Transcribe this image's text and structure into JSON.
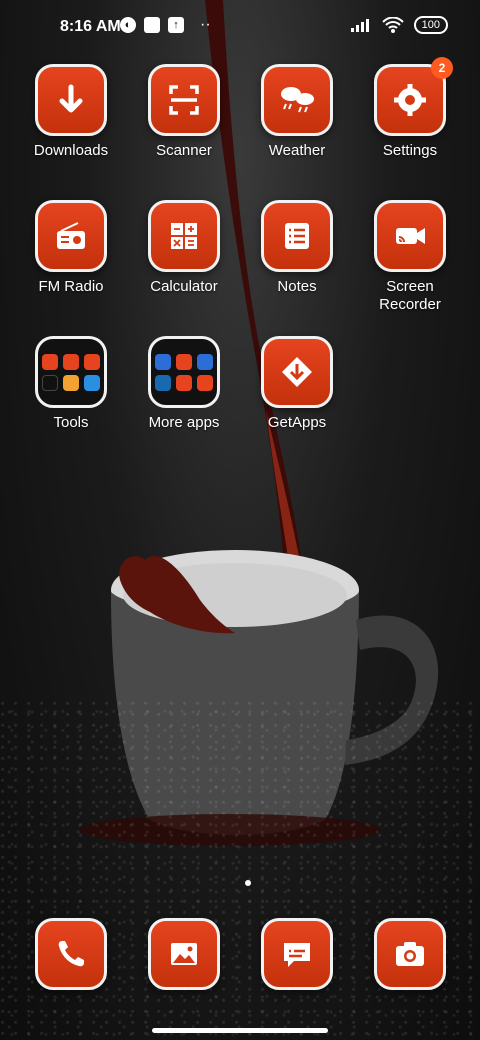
{
  "status_bar": {
    "time": "8:16 AM",
    "battery": "100",
    "left_icons": [
      "notification-icon",
      "square-icon",
      "upload-icon"
    ],
    "right_icons": [
      "signal-icon",
      "wifi-icon",
      "battery-icon"
    ]
  },
  "apps": [
    {
      "label": "Downloads",
      "icon": "download-icon"
    },
    {
      "label": "Scanner",
      "icon": "scanner-icon"
    },
    {
      "label": "Weather",
      "icon": "weather-icon"
    },
    {
      "label": "Settings",
      "icon": "settings-icon",
      "badge": "2"
    },
    {
      "label": "FM Radio",
      "icon": "radio-icon"
    },
    {
      "label": "Calculator",
      "icon": "calculator-icon"
    },
    {
      "label": "Notes",
      "icon": "notes-icon"
    },
    {
      "label": "Screen Recorder",
      "icon": "screen-recorder-icon"
    },
    {
      "label": "Tools",
      "icon": "folder-icon"
    },
    {
      "label": "More apps",
      "icon": "folder-icon"
    },
    {
      "label": "GetApps",
      "icon": "getapps-icon"
    }
  ],
  "dock": [
    {
      "label": "",
      "icon": "phone-icon"
    },
    {
      "label": "",
      "icon": "gallery-icon"
    },
    {
      "label": "",
      "icon": "messages-icon"
    },
    {
      "label": "",
      "icon": "camera-icon"
    }
  ],
  "colors": {
    "accent": "#d63a14",
    "icon_border": "#f2f2f2",
    "badge": "#ff5a1f"
  }
}
